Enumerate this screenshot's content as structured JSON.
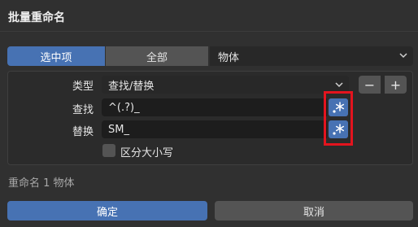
{
  "dialog": {
    "title": "批量重命名"
  },
  "scope": {
    "selected_label": "选中项",
    "all_label": "全部",
    "active": "选中项",
    "data_type": "物体"
  },
  "action": {
    "type_label": "类型",
    "type_value": "查找/替换",
    "remove_label": "−",
    "add_label": "+",
    "find_label": "查找",
    "find_value": "^(.?)_",
    "replace_label": "替换",
    "replace_value": "SM_",
    "regex_icon": "regex-icon",
    "case_label": "区分大小写",
    "case_checked": false
  },
  "status": {
    "text": "重命名 1 物体"
  },
  "footer": {
    "ok_label": "确定",
    "cancel_label": "取消"
  },
  "colors": {
    "accent": "#4772b3",
    "highlight": "#e3141e",
    "background": "#303030"
  }
}
